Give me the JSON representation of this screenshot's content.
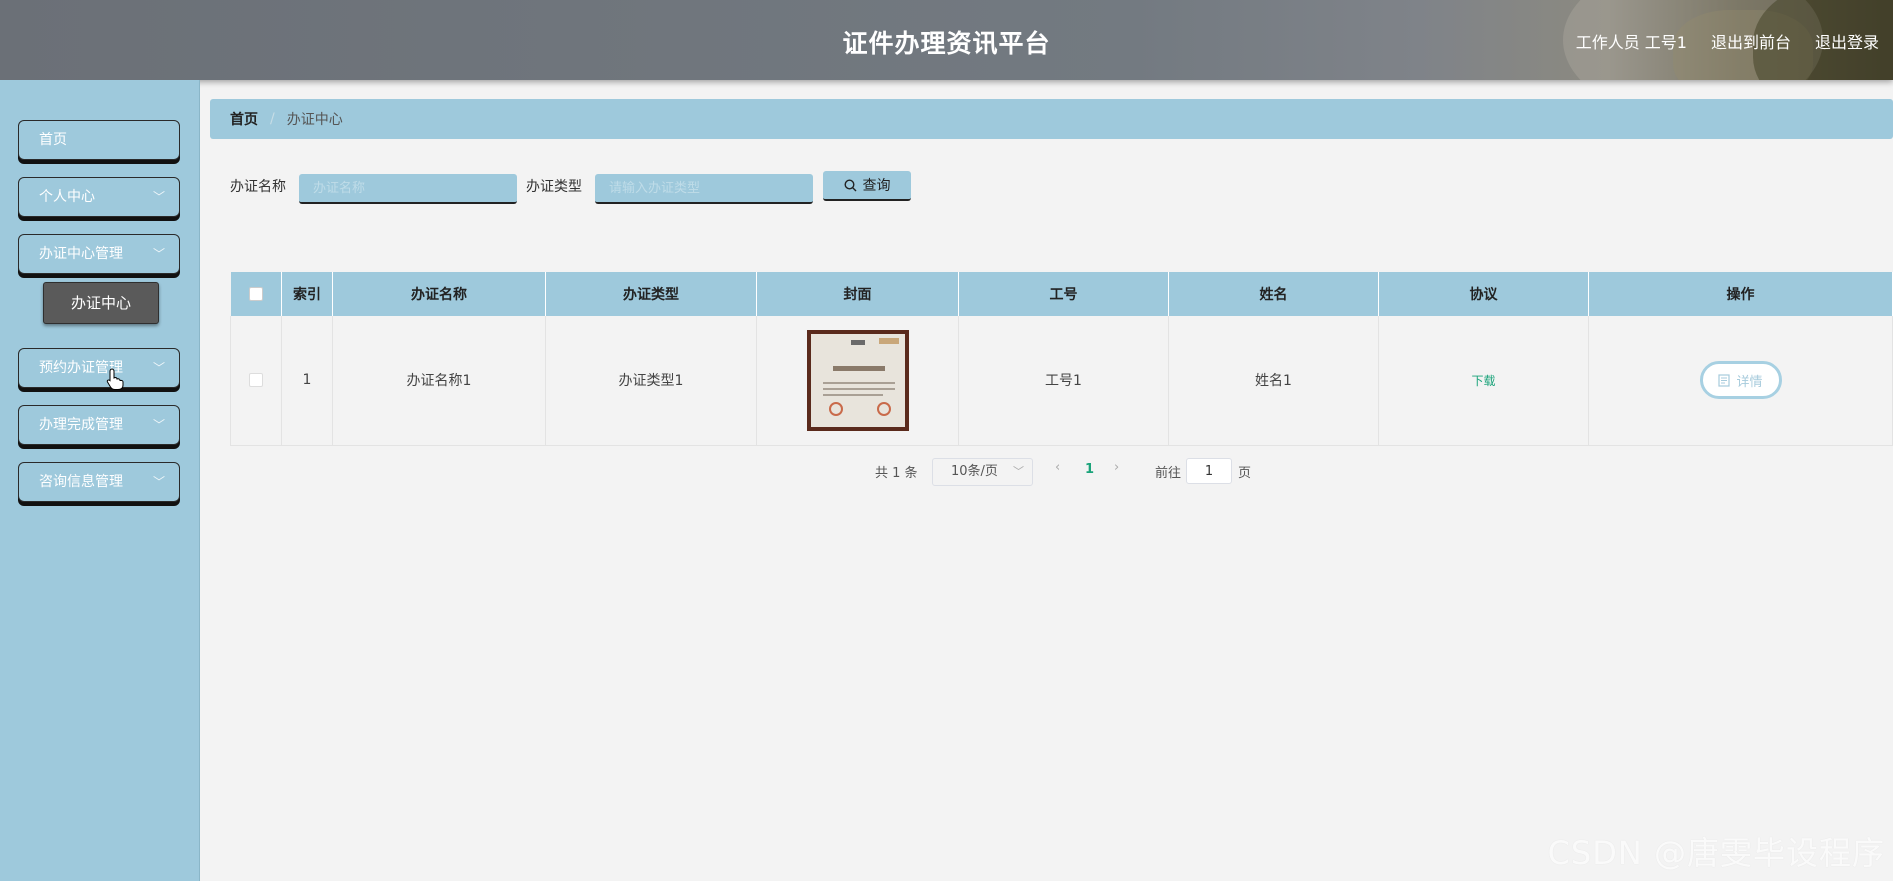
{
  "header": {
    "title": "证件办理资讯平台",
    "user": "工作人员 工号1",
    "back_to_front": "退出到前台",
    "logout": "退出登录"
  },
  "sidebar": {
    "items": [
      {
        "label": "首页",
        "has_arrow": false
      },
      {
        "label": "个人中心",
        "has_arrow": true
      },
      {
        "label": "办证中心管理",
        "has_arrow": true
      },
      {
        "label": "预约办证管理",
        "has_arrow": true
      },
      {
        "label": "办理完成管理",
        "has_arrow": true
      },
      {
        "label": "咨询信息管理",
        "has_arrow": true
      }
    ],
    "submenu_active": "办证中心",
    "arrow_glyph": "﹀"
  },
  "breadcrumb": {
    "home": "首页",
    "separator": "/",
    "current": "办证中心"
  },
  "search": {
    "name_label": "办证名称",
    "name_placeholder": "办证名称",
    "type_label": "办证类型",
    "type_placeholder": "请输入办证类型",
    "button_label": "查询"
  },
  "table": {
    "columns": [
      "",
      "索引",
      "办证名称",
      "办证类型",
      "封面",
      "工号",
      "姓名",
      "协议",
      "操作"
    ],
    "rows": [
      {
        "index": "1",
        "name": "办证名称1",
        "type": "办证类型1",
        "cover": "certificate-image",
        "employee_no": "工号1",
        "person": "姓名1",
        "agreement": "下载",
        "action": "详情"
      }
    ]
  },
  "pagination": {
    "total": "共 1 条",
    "page_size": "10条/页",
    "current_page": "1",
    "goto_label": "前往",
    "goto_value": "1",
    "goto_suffix": "页"
  },
  "watermark": "CSDN @唐雯毕设程序",
  "colors": {
    "accent": "#9ec9dc",
    "active_submenu": "#5a5a5a",
    "link_green": "#1aa37a"
  }
}
